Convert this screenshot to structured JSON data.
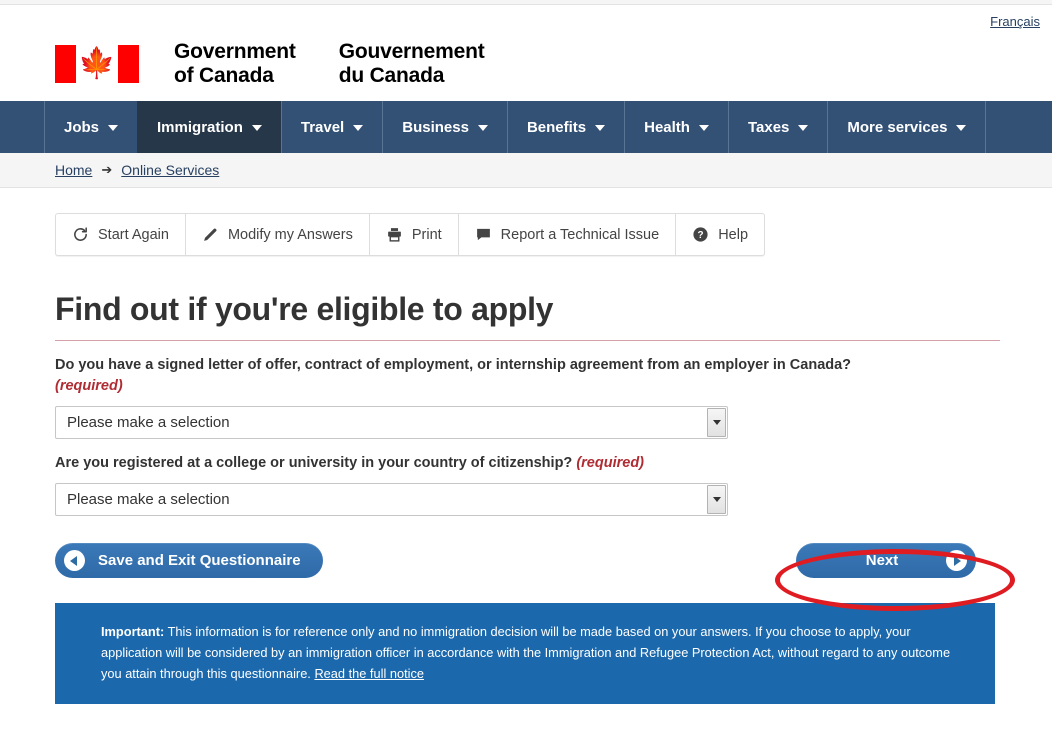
{
  "header": {
    "language_link": "Français",
    "wordmark_en": "Government\nof Canada",
    "wordmark_fr": "Gouvernement\ndu Canada",
    "flag_alt": "canada-flag"
  },
  "mainnav": {
    "items": [
      {
        "label": "Jobs",
        "active": false
      },
      {
        "label": "Immigration",
        "active": true
      },
      {
        "label": "Travel",
        "active": false
      },
      {
        "label": "Business",
        "active": false
      },
      {
        "label": "Benefits",
        "active": false
      },
      {
        "label": "Health",
        "active": false
      },
      {
        "label": "Taxes",
        "active": false
      },
      {
        "label": "More services",
        "active": false
      }
    ]
  },
  "breadcrumb": {
    "items": [
      "Home",
      "Online Services"
    ],
    "separator": "➔"
  },
  "toolbar": {
    "buttons": [
      {
        "label": "Start Again",
        "icon": "refresh-icon"
      },
      {
        "label": "Modify my Answers",
        "icon": "pencil-icon"
      },
      {
        "label": "Print",
        "icon": "printer-icon"
      },
      {
        "label": "Report a Technical Issue",
        "icon": "speech-bubble-icon"
      },
      {
        "label": "Help",
        "icon": "question-circle-icon"
      }
    ]
  },
  "main": {
    "title": "Find out if you're eligible to apply",
    "questions": [
      {
        "text": "Do you have a signed letter of offer, contract of employment, or internship agreement from an employer in Canada?",
        "required_label": "(required)",
        "required_on_new_line": true,
        "select_value": "Please make a selection"
      },
      {
        "text": "Are you registered at a college or university in your country of citizenship?",
        "required_label": "(required)",
        "required_on_new_line": false,
        "select_value": "Please make a selection"
      }
    ],
    "save_exit_label": "Save and Exit Questionnaire",
    "next_label": "Next"
  },
  "notice": {
    "label": "Important:",
    "body": " This information is for reference only and no immigration decision will be made based on your answers. If you choose to apply, your application will be considered by an immigration officer in accordance with the Immigration and Refugee Protection Act, without regard to any outcome you attain through this questionnaire. ",
    "link": "Read the full notice"
  },
  "annotation": {
    "shape": "ellipse",
    "color": "#e01c23",
    "target": "next-button"
  },
  "colors": {
    "nav_blue": "#335075",
    "nav_active": "#26374a",
    "button_blue": "#2e6da4",
    "notice_blue": "#1b69ac",
    "required_red": "#af2c33",
    "flag_red": "#ff0000",
    "annotation_red": "#e01c23"
  }
}
